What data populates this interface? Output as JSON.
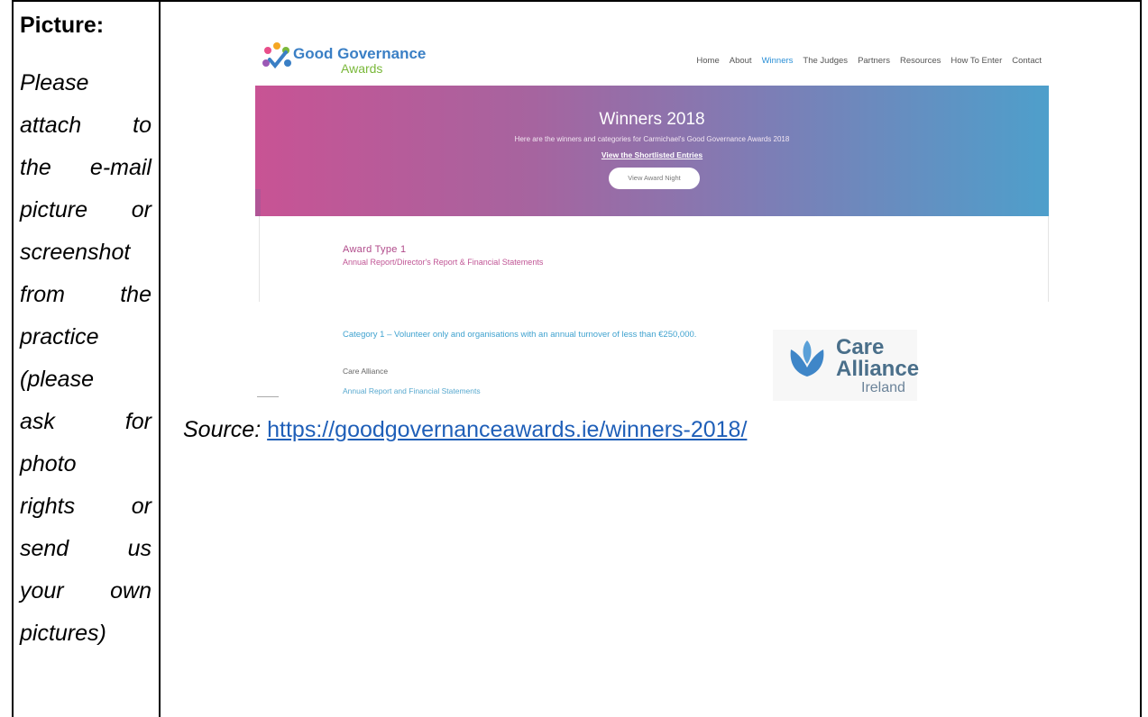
{
  "left": {
    "heading": "Picture:",
    "lines": [
      [
        "Please"
      ],
      [
        "attach",
        "to"
      ],
      [
        "the",
        "e-mail"
      ],
      [
        "picture",
        "or"
      ],
      [
        "screenshot"
      ],
      [
        "from",
        "the"
      ],
      [
        "practice"
      ],
      [
        "(please"
      ],
      [
        "ask",
        "for"
      ],
      [
        "photo"
      ],
      [
        "rights",
        "or"
      ],
      [
        "send",
        "us"
      ],
      [
        "your",
        "own"
      ],
      [
        "pictures)"
      ]
    ]
  },
  "screenshot": {
    "logo": {
      "title": "Good Governance",
      "subtitle": "Awards"
    },
    "nav": [
      "Home",
      "About",
      "Winners",
      "The Judges",
      "Partners",
      "Resources",
      "How To Enter",
      "Contact"
    ],
    "nav_active": "Winners",
    "hero": {
      "title": "Winners 2018",
      "subtitle": "Here are the winners and categories for Carmichael's Good Governance Awards 2018",
      "link": "View the Shortlisted Entries",
      "button": "View Award Night"
    },
    "award_type": "Award Type 1",
    "award_desc": "Annual Report/Director's Report & Financial Statements",
    "category": "Category 1 – Volunteer only and organisations with an annual turnover of less than €250,000.",
    "winner": "Care Alliance",
    "winner_link": "Annual Report and Financial Statements",
    "care_logo": {
      "line1": "Care",
      "line2": "Alliance",
      "line3": "Ireland"
    },
    "colors": {
      "hero_start": "#c85394",
      "hero_end": "#4e9fcb",
      "accent_blue": "#2a8fd6"
    }
  },
  "source": {
    "label": "Source:",
    "url": "https://goodgovernanceawards.ie/winners-2018/"
  }
}
